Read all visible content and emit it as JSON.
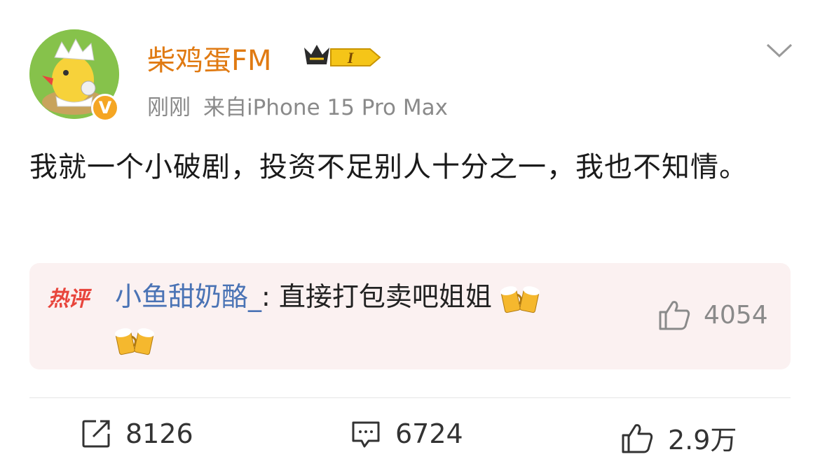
{
  "post": {
    "author": "柴鸡蛋FM",
    "rank_label": "I",
    "time": "刚刚",
    "source": "来自iPhone 15 Pro Max",
    "content": "我就一个小破剧，投资不足别人十分之一，我也不知情。"
  },
  "hot_comment": {
    "tag": "热评",
    "commenter": "小鱼甜奶酪_",
    "separator": ": ",
    "text": "直接打包卖吧姐姐",
    "likes": "4054"
  },
  "actions": {
    "repost_count": "8126",
    "comment_count": "6724",
    "like_count": "2.9万"
  },
  "colors": {
    "username": "#e07a12",
    "commenter": "#4a73b5",
    "hot_tag": "#e8453c",
    "hot_bg": "#fbf1f1"
  },
  "icons": {
    "verified": "v-badge-icon",
    "rank": "crown-rank-icon",
    "menu": "chevron-down-icon",
    "repost": "repost-icon",
    "comment": "comment-icon",
    "like": "thumbs-up-icon",
    "emoji": "beer-cheers-emoji"
  }
}
